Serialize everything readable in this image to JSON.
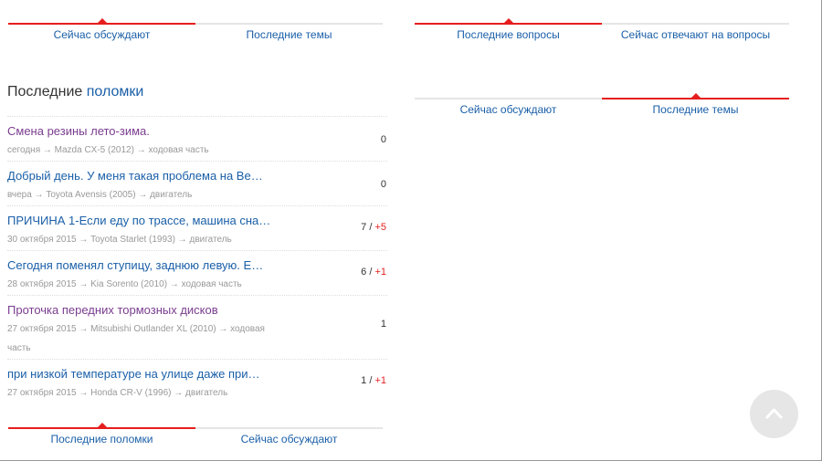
{
  "left_tabs_top": [
    {
      "label": "Сейчас обсуждают",
      "active": true
    },
    {
      "label": "Последние темы",
      "active": false
    }
  ],
  "right_tabs_top": [
    {
      "label": "Последние вопросы",
      "active": true
    },
    {
      "label": "Сейчас отвечают на вопросы",
      "active": false
    }
  ],
  "right_tabs_second": [
    {
      "label": "Сейчас обсуждают",
      "active": false
    },
    {
      "label": "Последние темы",
      "active": true
    }
  ],
  "section": {
    "title_prefix": "Последние",
    "title_highlight": "поломки"
  },
  "items": [
    {
      "title": "Смена резины лето-зима.",
      "meta": "сегодня → Mazda CX-5 (2012) → ходовая часть",
      "count": "0",
      "plus": ""
    },
    {
      "title": "Добрый день. У меня такая проблема на Ве…",
      "meta": "вчера → Toyota Avensis (2005) → двигатель",
      "count": "0",
      "plus": ""
    },
    {
      "title": "ПРИЧИНА 1-Если еду по трассе, машина сна…",
      "meta": "30 октября 2015 → Toyota Starlet (1993) → двигатель",
      "count": "7 / ",
      "plus": "+5"
    },
    {
      "title": "Сегодня поменял ступицу, заднюю левую. Е…",
      "meta": "28 октября 2015 → Kia Sorento (2010) → ходовая часть",
      "count": "6 / ",
      "plus": "+1"
    },
    {
      "title": "Проточка передних тормозных дисков",
      "meta": "27 октября 2015 → Mitsubishi Outlander XL (2010) → ходовая часть",
      "count": "1",
      "plus": ""
    },
    {
      "title": "при низкой температуре на улице даже при…",
      "meta": "27 октября 2015 → Honda CR-V (1996) → двигатель",
      "count": "1 / ",
      "plus": "+1"
    }
  ],
  "bottom_tabs": [
    {
      "label": "Последние поломки",
      "active": true
    },
    {
      "label": "Сейчас обсуждают",
      "active": false
    }
  ],
  "icons": {
    "scroll_top": "chevron-up-icon"
  },
  "colors": {
    "accent": "#e61e1e",
    "link": "#1a5fa8",
    "visited": "#7a3d8f",
    "meta": "#999999"
  }
}
